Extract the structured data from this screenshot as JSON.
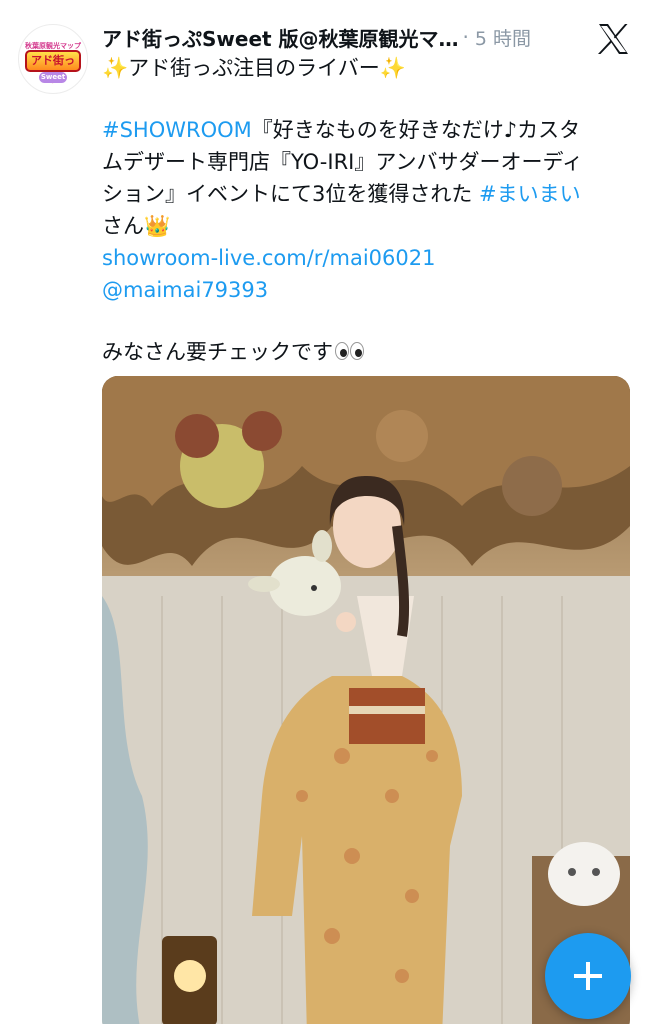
{
  "account": {
    "display_name": "アド街っぷSweet 版@秋葉原観光マ…",
    "separator": "·",
    "time": "5 時間",
    "avatar": {
      "top_text": "秋葉原観光マップ",
      "main_text": "アド街っぷ",
      "sub_text": "Sweet"
    }
  },
  "tweet": {
    "line1": {
      "sparkle_left": "✨",
      "text": "アド街っぷ注目のライバー",
      "sparkle_right": "✨"
    },
    "line2": {
      "hashtag": "#SHOWROOM",
      "text": "『好きなものを好きなだけ♪カスタ"
    },
    "line3": "ムデザート専門店『YO-IRI』アンバサダーオーディ",
    "line4": {
      "text": "ション』イベントにて3位を獲得された ",
      "hashtag": "#まいまい"
    },
    "line5": {
      "text": "さん",
      "emoji": "👑"
    },
    "link": "showroom-live.com/r/mai06021",
    "mention": "@maimai79393",
    "closing": "みなさん要チェックです"
  },
  "colors": {
    "accent": "#1d9bf0",
    "text": "#0f1419",
    "muted": "#8b98a5"
  },
  "icons": {
    "x_logo": "x-logo-icon",
    "compose": "plus-icon",
    "eyes": "eyes-emoji-icon",
    "crown": "crown-emoji-icon"
  }
}
